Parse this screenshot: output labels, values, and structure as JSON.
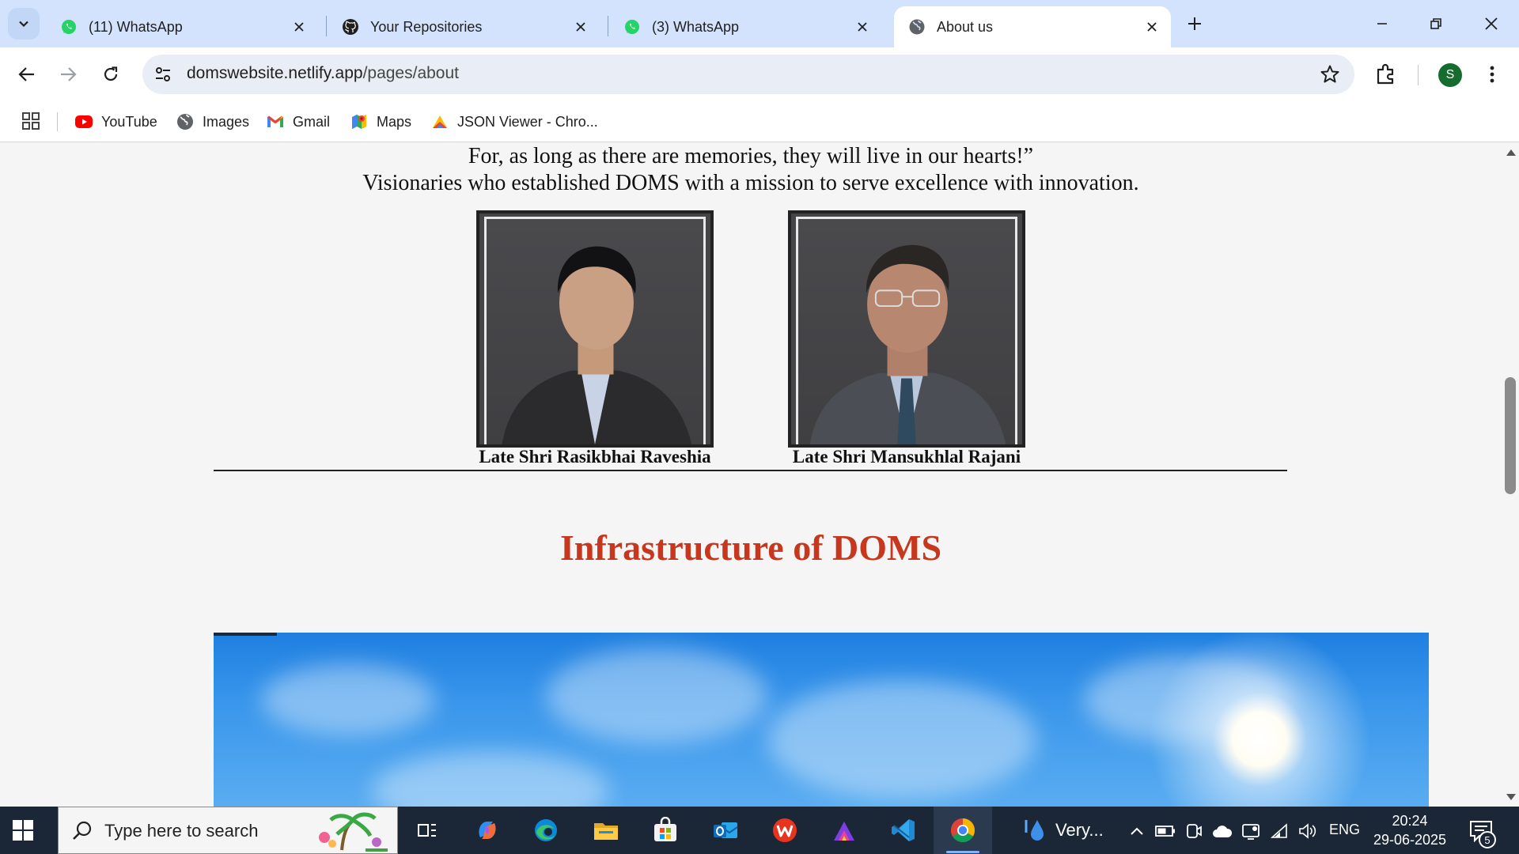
{
  "browser": {
    "tabs": [
      {
        "title": "(11) WhatsApp",
        "icon": "whatsapp-icon",
        "active": false
      },
      {
        "title": "Your Repositories",
        "icon": "github-icon",
        "active": false
      },
      {
        "title": "(3) WhatsApp",
        "icon": "whatsapp-icon",
        "active": false
      },
      {
        "title": "About us",
        "icon": "globe-icon",
        "active": true
      }
    ],
    "url_host": "domswebsite.netlify.app",
    "url_path": "/pages/about",
    "profile_initial": "S",
    "bookmarks": [
      {
        "label": "YouTube",
        "icon": "youtube-icon"
      },
      {
        "label": "Images",
        "icon": "globe-icon"
      },
      {
        "label": "Gmail",
        "icon": "gmail-icon"
      },
      {
        "label": "Maps",
        "icon": "maps-icon"
      },
      {
        "label": "JSON Viewer - Chro...",
        "icon": "json-viewer-icon"
      }
    ]
  },
  "page": {
    "quote_line1": "For, as long as there are memories, they will live in our hearts!”",
    "quote_line2": "Visionaries who established DOMS with a mission to serve excellence with innovation.",
    "founders": [
      {
        "name": "Late Shri Rasikbhai Raveshia"
      },
      {
        "name": "Late Shri Mansukhlal Rajani"
      }
    ],
    "section_title": "Infrastructure of DOMS",
    "title_color": "#c7371d"
  },
  "taskbar": {
    "search_placeholder": "Type here to search",
    "weather_text": "Very...",
    "language": "ENG",
    "time": "20:24",
    "date": "29-06-2025",
    "notification_count": "5"
  }
}
